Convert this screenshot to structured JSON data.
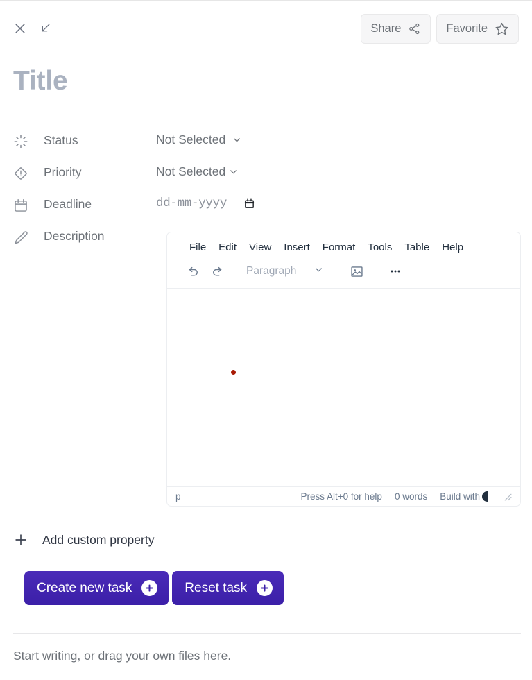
{
  "window": {
    "close_label": "close-window",
    "expand_label": "expand-window"
  },
  "header": {
    "share_label": "Share",
    "favorite_label": "Favorite"
  },
  "title": {
    "placeholder": "Title",
    "value": "Title"
  },
  "properties": [
    {
      "icon": "spinner-icon",
      "label": "Status",
      "type": "select",
      "value": "Not Selected"
    },
    {
      "icon": "priority-diamond-icon",
      "label": "Priority",
      "type": "select",
      "value": "Not Selected"
    },
    {
      "icon": "calendar-icon",
      "label": "Deadline",
      "type": "date",
      "value": "dd-mm-yyyy"
    },
    {
      "icon": "pencil-icon",
      "label": "Description",
      "type": "editor",
      "value": ""
    }
  ],
  "editor": {
    "menubar": [
      "File",
      "Edit",
      "View",
      "Insert",
      "Format",
      "Tools",
      "Table",
      "Help"
    ],
    "toolbar": {
      "undo": "undo-icon",
      "redo": "redo-icon",
      "block_format": "Paragraph",
      "image": "image-icon",
      "more": "more-options-icon"
    },
    "content": "",
    "statusbar": {
      "element_path": "p",
      "help_text": "Press Alt+0 for help",
      "word_count": "0 words",
      "brand": "Build with"
    }
  },
  "add_property": {
    "label": "Add custom property",
    "icon": "plus-icon"
  },
  "actions": [
    {
      "label": "Create new task",
      "icon": "plus-circle-icon"
    },
    {
      "label": "Reset task",
      "icon": "plus-circle-icon"
    }
  ],
  "footer": {
    "hint": "Start writing, or drag your own files here."
  },
  "colors": {
    "accent": "#3b1fa8",
    "title_placeholder": "#aab2c0",
    "text_muted": "#6d7278",
    "marker": "#a81a05"
  }
}
